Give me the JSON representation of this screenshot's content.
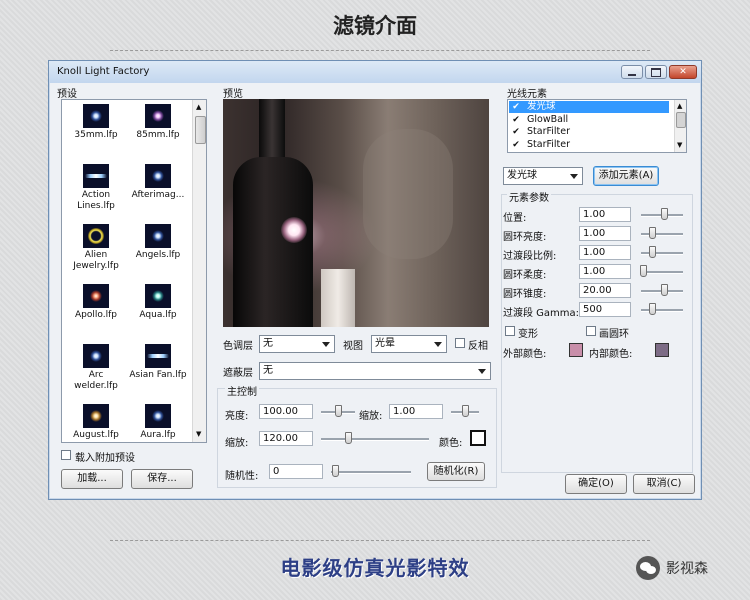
{
  "page": {
    "title": "滤镜介面",
    "caption": "电影级仿真光影特效",
    "wechat": "影视森"
  },
  "window": {
    "title": "Knoll Light Factory",
    "close_glyph": "✕",
    "presets": {
      "label": "预设",
      "items": [
        {
          "name": "35mm.lfp",
          "icon": "flare-icon"
        },
        {
          "name": "85mm.lfp",
          "icon": "flare-icon"
        },
        {
          "name": "Action\nLines.lfp",
          "icon": "flare-icon"
        },
        {
          "name": "Afterimag...",
          "icon": "flare-icon"
        },
        {
          "name": "Alien\nJewelry.lfp",
          "icon": "flare-icon"
        },
        {
          "name": "Angels.lfp",
          "icon": "flare-icon"
        },
        {
          "name": "Apollo.lfp",
          "icon": "flare-icon"
        },
        {
          "name": "Aqua.lfp",
          "icon": "flare-icon"
        },
        {
          "name": "Arc\nwelder.lfp",
          "icon": "flare-icon"
        },
        {
          "name": "Asian Fan.lfp",
          "icon": "flare-icon"
        },
        {
          "name": "August.lfp",
          "icon": "flare-icon"
        },
        {
          "name": "Aura.lfp",
          "icon": "flare-icon"
        }
      ],
      "load_extra_label": "载入附加预设",
      "load_extra_checked": false,
      "load_button": "加载...",
      "save_button": "保存..."
    },
    "preview": {
      "label": "预览",
      "tone_label": "色调层",
      "tone_value": "无",
      "view_label": "视图",
      "view_value": "光晕",
      "invert_label": "反相",
      "invert_checked": false,
      "mask_label": "遮蔽层",
      "mask_value": "无"
    },
    "master": {
      "label": "主控制",
      "brightness_label": "亮度:",
      "brightness_value": "100.00",
      "brightness_level": 0.5,
      "scale1_label": "缩放:",
      "scale1_value": "1.00",
      "scale1_level": 0.5,
      "scale2_label": "缩放:",
      "scale2_value": "120.00",
      "scale2_level": 0.25,
      "color_label": "颜色:",
      "color": "#ffffff",
      "random_label": "随机性:",
      "random_value": "0",
      "random_level": 0.05,
      "randomize_button": "随机化(R)"
    },
    "elements": {
      "label": "光线元素",
      "items": [
        {
          "name": "发光球",
          "checked": true,
          "selected": true
        },
        {
          "name": "GlowBall",
          "checked": true,
          "selected": false
        },
        {
          "name": "StarFilter",
          "checked": true,
          "selected": false
        },
        {
          "name": "StarFilter",
          "checked": true,
          "selected": false
        }
      ],
      "type_value": "发光球",
      "add_button": "添加元素(A)"
    },
    "params": {
      "label": "元素参数",
      "rows": [
        {
          "label": "位置:",
          "value": "1.00",
          "level": 0.55
        },
        {
          "label": "圆环亮度:",
          "value": "1.00",
          "level": 0.25
        },
        {
          "label": "过渡段比例:",
          "value": "1.00",
          "level": 0.25
        },
        {
          "label": "圆环柔度:",
          "value": "1.00",
          "level": 0.05
        },
        {
          "label": "圆环锥度:",
          "value": "20.00",
          "level": 0.55
        },
        {
          "label": "过渡段 Gamma:",
          "value": "500",
          "level": 0.25
        }
      ],
      "deform_label": "变形",
      "deform_checked": false,
      "draw_ring_label": "画圆环",
      "draw_ring_checked": false,
      "outer_color_label": "外部颜色:",
      "outer_color": "#c98faa",
      "inner_color_label": "内部颜色:",
      "inner_color": "#7d6c86"
    },
    "ok_button": "确定(O)",
    "cancel_button": "取消(C)"
  }
}
